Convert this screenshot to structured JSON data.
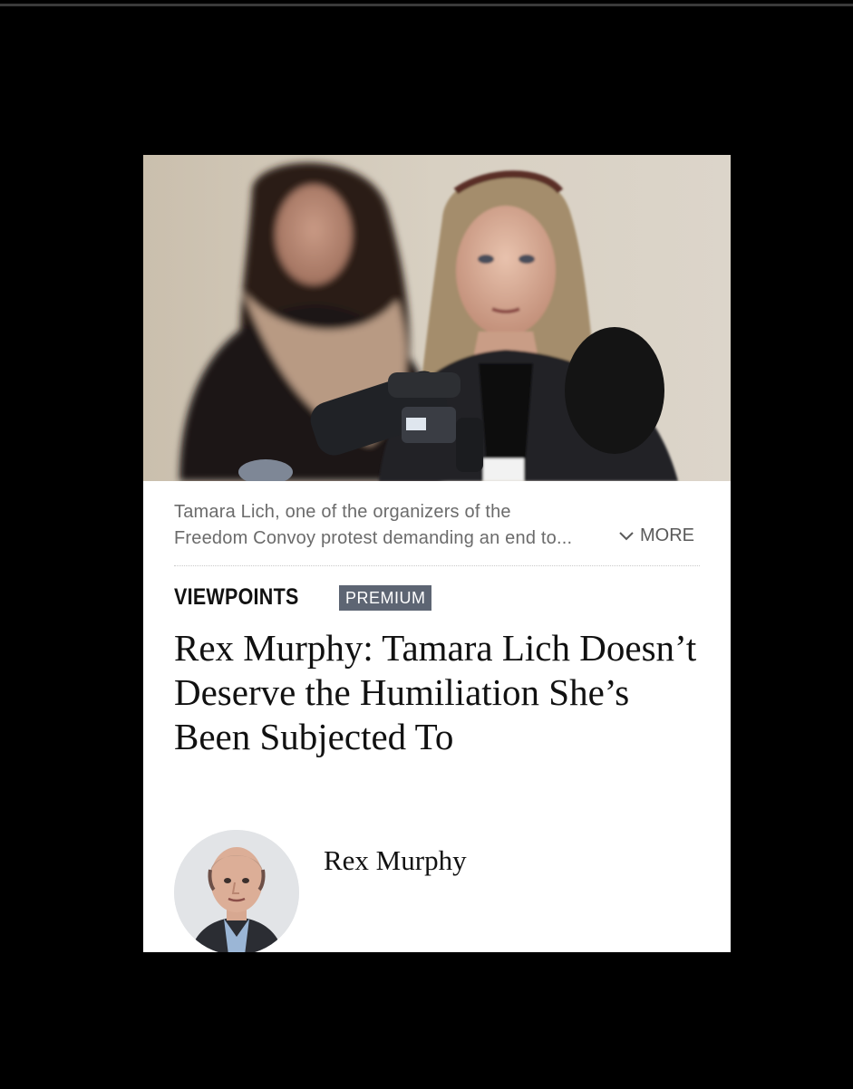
{
  "article": {
    "photo_alt": "Tamara Lich speaking at a press conference with microphones",
    "caption_line1": "Tamara Lich, one of the organizers of the",
    "caption_line2": "Freedom Convoy protest demanding an end to...",
    "more_label": "MORE",
    "section": "VIEWPOINTS",
    "badge": "PREMIUM",
    "headline": "Rex Murphy: Tamara Lich Doesn’t Deserve the Humiliation She’s Been Subjected To",
    "author": "Rex Murphy"
  },
  "colors": {
    "page_background": "#000000",
    "card_background": "#ffffff",
    "badge_background": "#5d6573",
    "caption_text": "#6b6b6b"
  },
  "icons": {
    "more": "chevron-down-icon"
  }
}
